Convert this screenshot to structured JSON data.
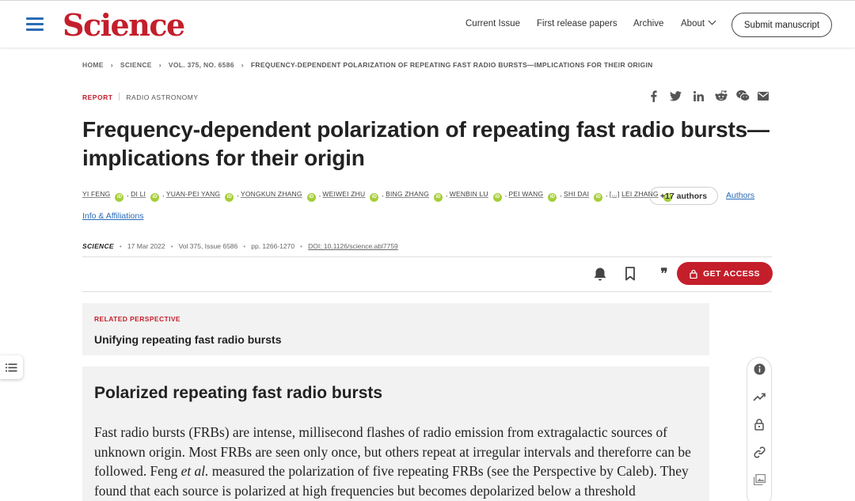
{
  "header": {
    "logo": "Science",
    "nav": [
      "Current Issue",
      "First release papers",
      "Archive",
      "About"
    ],
    "submit_label": "Submit manuscript"
  },
  "breadcrumb": [
    "HOME",
    "SCIENCE",
    "VOL. 375, NO. 6586",
    "FREQUENCY-DEPENDENT POLARIZATION OF REPEATING FAST RADIO BURSTS—IMPLICATIONS FOR THEIR ORIGIN"
  ],
  "article": {
    "type": "REPORT",
    "field": "RADIO ASTRONOMY",
    "title_line1": "Frequency-dependent polarization of repeating fast radio bursts—",
    "title_line2": "implications for their origin",
    "authors": [
      "YI FENG",
      "DI LI",
      "YUAN-PEI YANG",
      "YONGKUN ZHANG",
      "WEIWEI ZHU",
      "BING ZHANG",
      "WENBIN LU",
      "PEI WANG",
      "SHI DAI",
      "[...]",
      "LEI ZHANG"
    ],
    "orcid_mark": "iD",
    "more_authors": "+17 authors",
    "authors_link": "Authors",
    "info_link": "Info & Affiliations",
    "journal": "SCIENCE",
    "date": "17 Mar 2022",
    "volume": "Vol 375, Issue 6586",
    "pages": "pp. 1266-1270",
    "doi": "DOI: 10.1126/science.abl7759"
  },
  "toolbar": {
    "get_access": "GET ACCESS",
    "quote_glyph": "❞"
  },
  "share_icons": [
    "facebook-icon",
    "twitter-icon",
    "linkedin-icon",
    "reddit-icon",
    "wechat-icon",
    "email-icon"
  ],
  "related": {
    "label": "RELATED PERSPECTIVE",
    "title": "Unifying repeating fast radio bursts"
  },
  "abstract": {
    "heading": "Polarized repeating fast radio bursts",
    "text_before": "Fast radio bursts (FRBs) are intense, millisecond flashes of radio emission from extragalactic sources of unknown origin. Most FRBs are seen only once, but others repeat at irregular intervals and thereforre can be followed. Feng ",
    "text_italic": "et al.",
    "text_after": " measured the polarization of five repeating FRBs (see the Perspective by Caleb). They found that each source is polarized at high frequencies but becomes depolarized below a threshold"
  },
  "colors": {
    "brand_red": "#c41e2b",
    "link_blue": "#2a6bb5",
    "orcid_green": "#a6ce39",
    "panel_gray": "#f2f2f2"
  }
}
